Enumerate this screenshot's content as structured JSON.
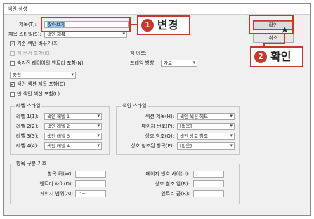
{
  "window": {
    "title": "색인 생성"
  },
  "form": {
    "title_label": "제목(T):",
    "title_value": "찾아보기",
    "title_style_label": "제목 스타일(S):",
    "title_style_value": "색인 제목",
    "replace_existing": "기존 색인 바꾸기(X)",
    "include_book": "책 문서 포함(K)",
    "include_hidden": "숨겨진 레이어의 엔트리 포함(N)",
    "book_name_label": "책 이름:",
    "frame_direction_label": "프레임 방향:",
    "frame_direction_value": "가로",
    "nested_value": "중첩",
    "include_section_headings": "색인 섹션 제목 포함(C)",
    "include_empty_sections": "빈 색인 섹션 포함(L)"
  },
  "level_style": {
    "title": "레벨 스타일",
    "rows": [
      {
        "label": "레벨 1(1):",
        "value": "색인 레벨 1"
      },
      {
        "label": "레벨 2(2):",
        "value": "색인 레벨 2"
      },
      {
        "label": "레벨 3(3):",
        "value": "색인 레벨 3"
      },
      {
        "label": "레벨 4(4):",
        "value": "색인 레벨 4"
      }
    ]
  },
  "index_style": {
    "title": "색인 스타일",
    "rows": [
      {
        "label": "섹션 제목(H):",
        "value": "색인 섹션 헤드"
      },
      {
        "label": "페이지 번호(P):",
        "value": "[없음]"
      },
      {
        "label": "상호 참조(O):",
        "value": "색인 상호 참조"
      },
      {
        "label": "상호 참조된 항목(E):",
        "value": "[없음]"
      }
    ]
  },
  "separators": {
    "title": "항목 구분 기호",
    "left": [
      {
        "label": "항목 뒤(W):",
        "value": ""
      },
      {
        "label": "엔트리 사이(D):",
        "value": ";"
      },
      {
        "label": "페이지 범위(A):",
        "value": "^="
      }
    ],
    "right": [
      {
        "label": "페이지 번호 사이(U):",
        "value": ","
      },
      {
        "label": "상호 참조 앞(B):",
        "value": "."
      },
      {
        "label": "엔트리 끝(R):",
        "value": ""
      }
    ]
  },
  "buttons": {
    "ok": "확인",
    "cancel": "취소"
  },
  "callouts": {
    "one_num": "1",
    "one_text": "변경",
    "two_num": "2",
    "two_text": "확인"
  },
  "colors": {
    "accent": "#c8372d",
    "dialog_bg": "#f0f0f0",
    "field_highlight": "#99c9ef"
  }
}
